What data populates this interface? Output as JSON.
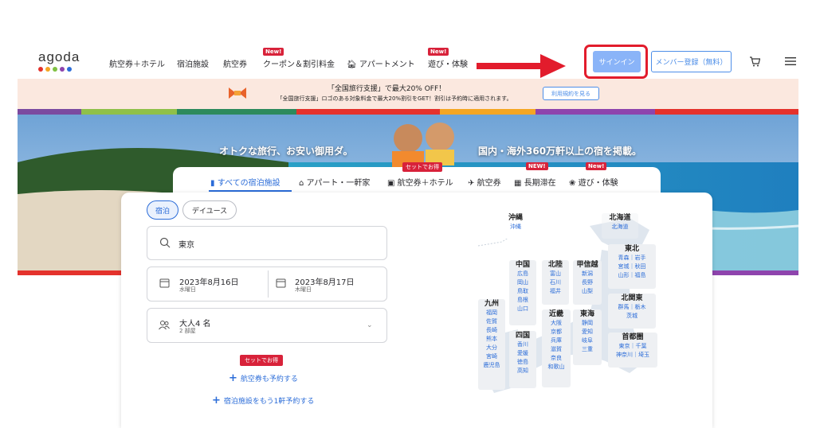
{
  "header": {
    "logo": "agoda",
    "logo_colors": [
      "#e4322c",
      "#f5a623",
      "#7fc142",
      "#8e44ad",
      "#2b6cd8"
    ],
    "nav": {
      "flight_hotel": "航空券＋ホテル",
      "hotels": "宿泊施設",
      "flights": "航空券",
      "coupons": "クーポン＆割引料金",
      "apartments": "アパートメント",
      "activities": "遊び・体験"
    },
    "new_badge": "New!",
    "signin": "サインイン",
    "signup": "メンバー登録（無料）"
  },
  "promo": {
    "line1": "「全国旅行支援」で最大20% OFF！",
    "line2": "「全国旅行支援」ロゴのある対象料金で最大20%割引をGET！割引は予約時に適用されます。",
    "terms": "利用規約を見る"
  },
  "hero": {
    "left_text": "オトクな旅行、お安い御用ダ。",
    "right_text": "国内・海外360万軒以上の宿を掲載。"
  },
  "tabs": {
    "set_badge": "セットでお得",
    "new_badge": "NEW!",
    "new_badge2": "New!",
    "all": "すべての宿泊施設",
    "apartment": "アパート・一軒家",
    "flight_hotel": "航空券＋ホテル",
    "flight": "航空券",
    "long_stay": "長期滞在",
    "activities": "遊び・体験"
  },
  "search": {
    "pill_stay": "宿泊",
    "pill_day": "デイユース",
    "destination": "東京",
    "checkin_date": "2023年8月16日",
    "checkin_day": "水曜日",
    "checkout_date": "2023年8月17日",
    "checkout_day": "木曜日",
    "guests": "大人4 名",
    "rooms": "2 部屋",
    "set_badge": "セットでお得",
    "add_flight": "航空券も予約する",
    "add_hotel": "宿泊施設をもう1軒予約する"
  },
  "map": {
    "okinawa": {
      "title": "沖縄",
      "p": [
        "沖縄"
      ]
    },
    "hokkaido": {
      "title": "北海道",
      "p": [
        "北海道"
      ]
    },
    "tohoku": {
      "title": "東北",
      "p": [
        "青森｜岩手",
        "宮城｜秋田",
        "山形｜福島"
      ]
    },
    "chugoku": {
      "title": "中国",
      "p": [
        "広島",
        "岡山",
        "鳥取",
        "島根",
        "山口"
      ]
    },
    "hokuriku": {
      "title": "北陸",
      "p": [
        "富山",
        "石川",
        "福井"
      ]
    },
    "koshinetsu": {
      "title": "甲信越",
      "p": [
        "新潟",
        "長野",
        "山梨"
      ]
    },
    "kanto": {
      "title": "北関東",
      "p": [
        "群馬｜栃木",
        "茨城"
      ]
    },
    "kyushu": {
      "title": "九州",
      "p": [
        "福岡",
        "佐賀",
        "長崎",
        "熊本",
        "大分",
        "宮崎",
        "鹿児島"
      ]
    },
    "kinki": {
      "title": "近畿",
      "p": [
        "大阪",
        "京都",
        "兵庫",
        "滋賀",
        "奈良",
        "和歌山"
      ]
    },
    "tokai": {
      "title": "東海",
      "p": [
        "静岡",
        "愛知",
        "岐阜",
        "三重"
      ]
    },
    "shikoku": {
      "title": "四国",
      "p": [
        "香川",
        "愛媛",
        "徳島",
        "高知"
      ]
    },
    "shutoken": {
      "title": "首都圏",
      "p": [
        "東京｜千葉",
        "神奈川｜埼玉"
      ]
    }
  }
}
